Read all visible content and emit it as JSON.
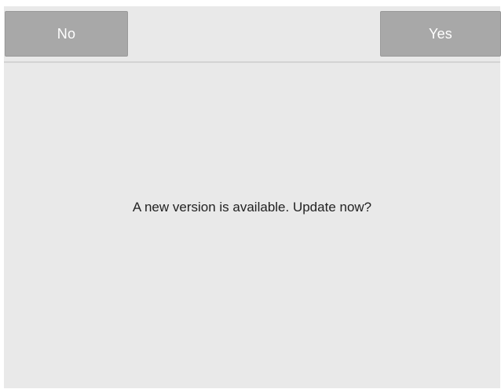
{
  "dialog": {
    "buttons": {
      "no_label": "No",
      "yes_label": "Yes"
    },
    "message": "A new version is available. Update now?"
  },
  "colors": {
    "background": "#e9e9e9",
    "button": "#a8a8a8",
    "button_text": "#ffffff",
    "message_text": "#222222"
  }
}
